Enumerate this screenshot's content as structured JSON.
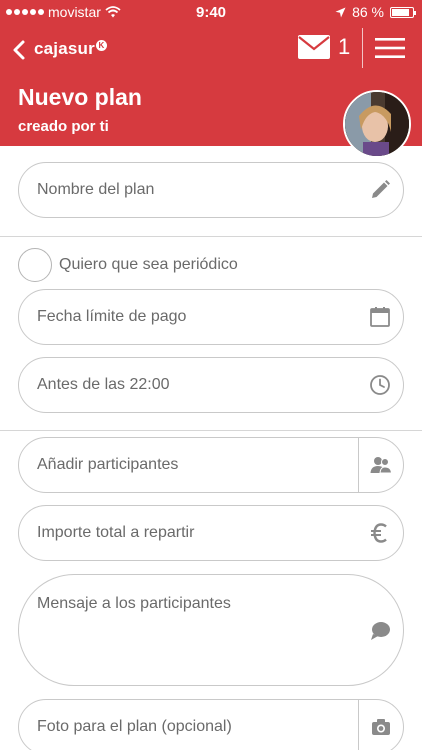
{
  "status_bar": {
    "carrier": "movistar",
    "time": "9:40",
    "battery": "86 %",
    "battery_level": 0.86
  },
  "nav": {
    "brand": "cajasur",
    "brand_badge": "K",
    "mail_count": "1"
  },
  "header": {
    "title": "Nuevo plan",
    "subtitle": "creado por ti"
  },
  "form": {
    "plan_name": "Nombre del plan",
    "periodic": "Quiero que sea periódico",
    "due_date": "Fecha límite de pago",
    "before_time": "Antes de las 22:00",
    "participants": "Añadir participantes",
    "total_amount": "Importe total a repartir",
    "message": "Mensaje a los participantes",
    "photo": "Foto para el plan (opcional)"
  },
  "colors": {
    "brand_red": "#d63a3f",
    "field_border": "#c9c9c9",
    "field_text": "#6a6a6a",
    "icon_gray": "#8a8a8a"
  }
}
